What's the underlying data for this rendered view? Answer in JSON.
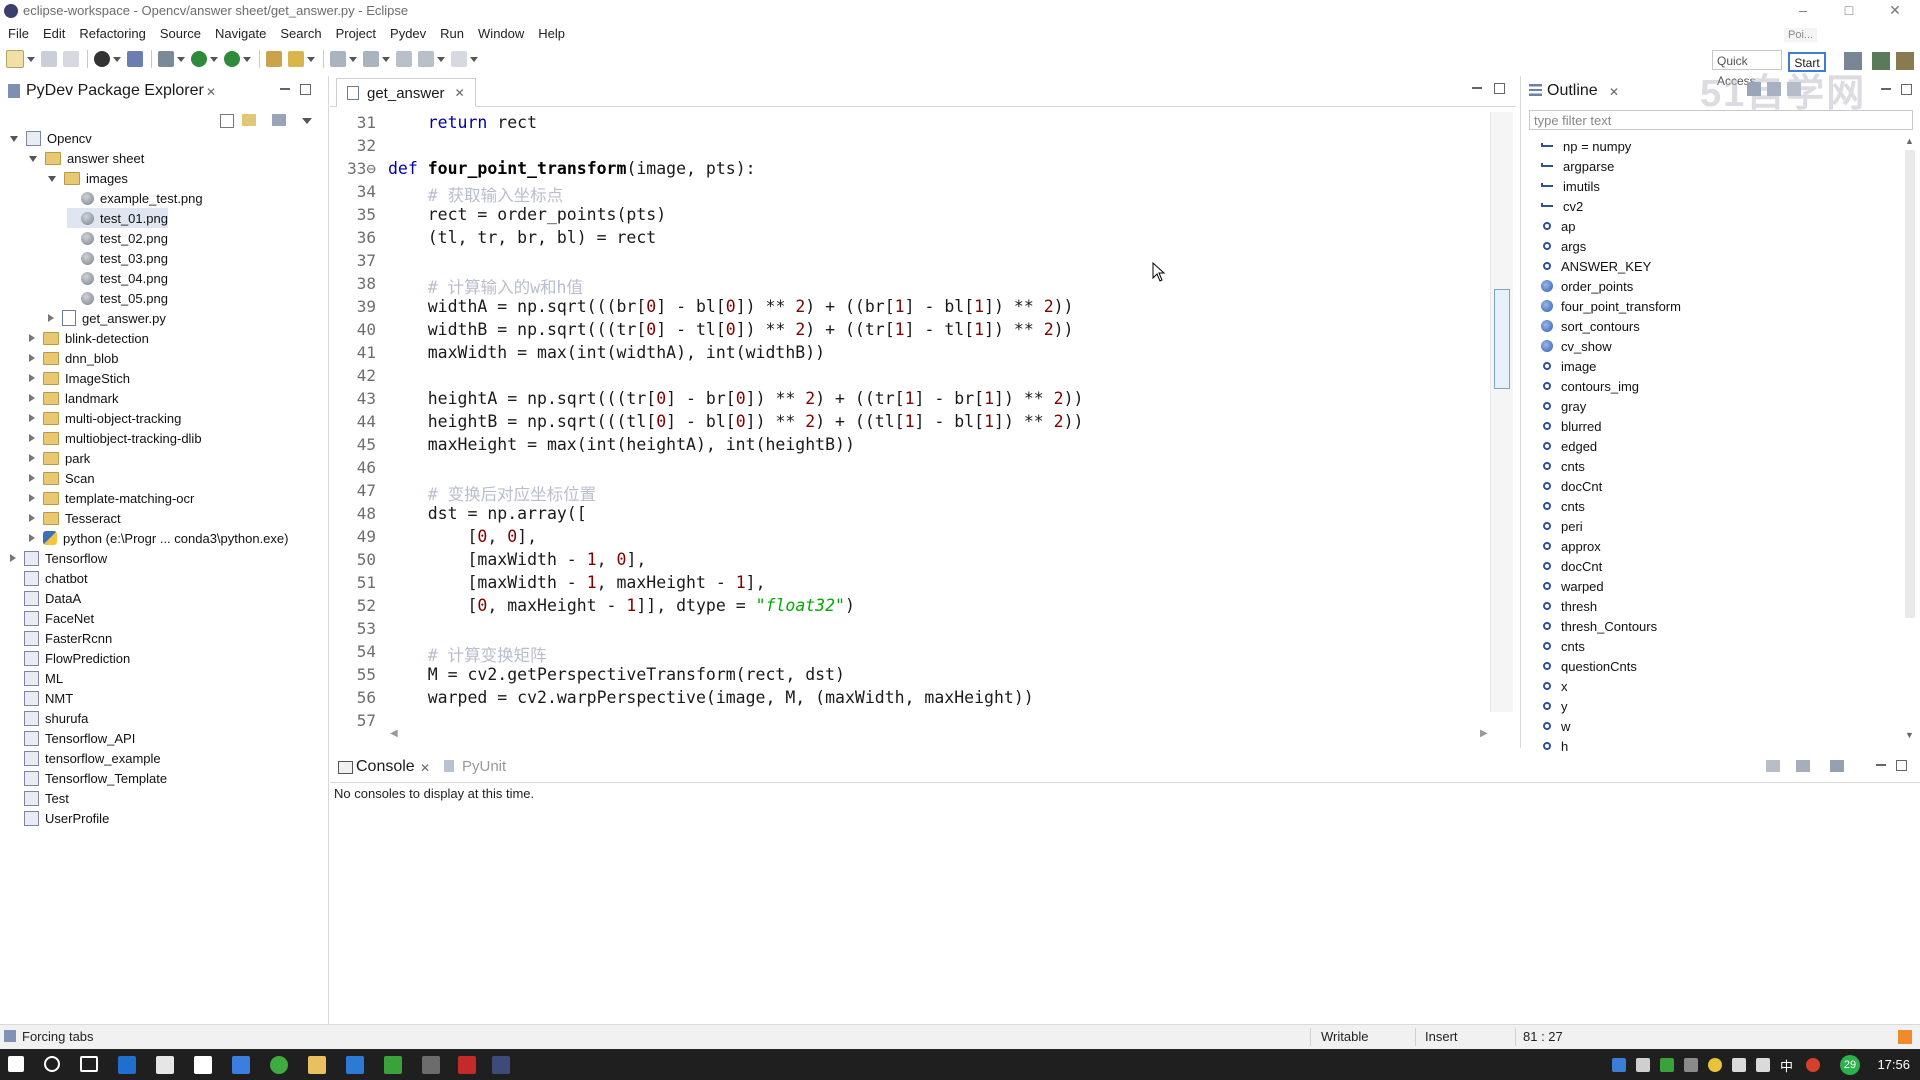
{
  "window": {
    "title": "eclipse-workspace - Opencv/answer sheet/get_answer.py - Eclipse",
    "minimize": "–",
    "maximize": "□",
    "close": "✕"
  },
  "menu": [
    "File",
    "Edit",
    "Refactoring",
    "Source",
    "Navigate",
    "Search",
    "Project",
    "Pydev",
    "Run",
    "Window",
    "Help"
  ],
  "quick_access": {
    "placeholder": "Quick Access",
    "start": "Start",
    "popup": "Poi..."
  },
  "watermark": "51自学网",
  "explorer": {
    "title": "PyDev Package Explorer",
    "tree": [
      {
        "label": "Opencv",
        "indent": 0,
        "twisty": "open",
        "icon": "project"
      },
      {
        "label": "answer sheet",
        "indent": 1,
        "twisty": "open",
        "icon": "folder"
      },
      {
        "label": "images",
        "indent": 2,
        "twisty": "open",
        "icon": "folder"
      },
      {
        "label": "example_test.png",
        "indent": 3,
        "twisty": "none",
        "icon": "file"
      },
      {
        "label": "test_01.png",
        "indent": 3,
        "twisty": "none",
        "icon": "file",
        "selected": true
      },
      {
        "label": "test_02.png",
        "indent": 3,
        "twisty": "none",
        "icon": "file"
      },
      {
        "label": "test_03.png",
        "indent": 3,
        "twisty": "none",
        "icon": "file"
      },
      {
        "label": "test_04.png",
        "indent": 3,
        "twisty": "none",
        "icon": "file"
      },
      {
        "label": "test_05.png",
        "indent": 3,
        "twisty": "none",
        "icon": "file"
      },
      {
        "label": "get_answer.py",
        "indent": 2,
        "twisty": "closed",
        "icon": "py"
      },
      {
        "label": "blink-detection",
        "indent": 1,
        "twisty": "closed",
        "icon": "folder"
      },
      {
        "label": "dnn_blob",
        "indent": 1,
        "twisty": "closed",
        "icon": "folder"
      },
      {
        "label": "ImageStich",
        "indent": 1,
        "twisty": "closed",
        "icon": "folder"
      },
      {
        "label": "landmark",
        "indent": 1,
        "twisty": "closed",
        "icon": "folder"
      },
      {
        "label": "multi-object-tracking",
        "indent": 1,
        "twisty": "closed",
        "icon": "folder"
      },
      {
        "label": "multiobject-tracking-dlib",
        "indent": 1,
        "twisty": "closed",
        "icon": "folder"
      },
      {
        "label": "park",
        "indent": 1,
        "twisty": "closed",
        "icon": "folder"
      },
      {
        "label": "Scan",
        "indent": 1,
        "twisty": "closed",
        "icon": "folder"
      },
      {
        "label": "template-matching-ocr",
        "indent": 1,
        "twisty": "closed",
        "icon": "folder"
      },
      {
        "label": "Tesseract",
        "indent": 1,
        "twisty": "closed",
        "icon": "folder"
      },
      {
        "label": "python  (e:\\Progr ... conda3\\python.exe)",
        "indent": 1,
        "twisty": "closed",
        "icon": "interp"
      },
      {
        "label": "Tensorflow",
        "indent": 0,
        "twisty": "closed",
        "icon": "project"
      },
      {
        "label": "chatbot",
        "indent": 0,
        "twisty": "none",
        "icon": "project"
      },
      {
        "label": "DataA",
        "indent": 0,
        "twisty": "none",
        "icon": "project"
      },
      {
        "label": "FaceNet",
        "indent": 0,
        "twisty": "none",
        "icon": "project"
      },
      {
        "label": "FasterRcnn",
        "indent": 0,
        "twisty": "none",
        "icon": "project"
      },
      {
        "label": "FlowPrediction",
        "indent": 0,
        "twisty": "none",
        "icon": "project"
      },
      {
        "label": "ML",
        "indent": 0,
        "twisty": "none",
        "icon": "project"
      },
      {
        "label": "NMT",
        "indent": 0,
        "twisty": "none",
        "icon": "project"
      },
      {
        "label": "shurufa",
        "indent": 0,
        "twisty": "none",
        "icon": "project"
      },
      {
        "label": "Tensorflow_API",
        "indent": 0,
        "twisty": "none",
        "icon": "project"
      },
      {
        "label": "tensorflow_example",
        "indent": 0,
        "twisty": "none",
        "icon": "project"
      },
      {
        "label": "Tensorflow_Template",
        "indent": 0,
        "twisty": "none",
        "icon": "project"
      },
      {
        "label": "Test",
        "indent": 0,
        "twisty": "none",
        "icon": "project"
      },
      {
        "label": "UserProfile",
        "indent": 0,
        "twisty": "none",
        "icon": "project"
      }
    ]
  },
  "editor": {
    "tab": "get_answer",
    "lines": [
      {
        "n": "31",
        "html": "    <span class='kw'>return</span> rect"
      },
      {
        "n": "32",
        "html": ""
      },
      {
        "n": "33⊖",
        "html": "<span class='kw'>def</span> <span class='fn'>four_point_transform</span>(image, pts):"
      },
      {
        "n": "34",
        "html": "    <span class='cm'># 获取输入坐标点</span>"
      },
      {
        "n": "35",
        "html": "    rect = order_points(pts)"
      },
      {
        "n": "36",
        "html": "    (tl, tr, br, bl) = rect"
      },
      {
        "n": "37",
        "html": ""
      },
      {
        "n": "38",
        "html": "    <span class='cm'># 计算输入的w和h值</span>"
      },
      {
        "n": "39",
        "html": "    widthA = np.sqrt(((br[<span class='num'>0</span>] - bl[<span class='num'>0</span>]) ** <span class='num'>2</span>) + ((br[<span class='num'>1</span>] - bl[<span class='num'>1</span>]) ** <span class='num'>2</span>))"
      },
      {
        "n": "40",
        "html": "    widthB = np.sqrt(((tr[<span class='num'>0</span>] - tl[<span class='num'>0</span>]) ** <span class='num'>2</span>) + ((tr[<span class='num'>1</span>] - tl[<span class='num'>1</span>]) ** <span class='num'>2</span>))"
      },
      {
        "n": "41",
        "html": "    maxWidth = max(int(widthA), int(widthB))"
      },
      {
        "n": "42",
        "html": ""
      },
      {
        "n": "43",
        "html": "    heightA = np.sqrt(((tr[<span class='num'>0</span>] - br[<span class='num'>0</span>]) ** <span class='num'>2</span>) + ((tr[<span class='num'>1</span>] - br[<span class='num'>1</span>]) ** <span class='num'>2</span>))"
      },
      {
        "n": "44",
        "html": "    heightB = np.sqrt(((tl[<span class='num'>0</span>] - bl[<span class='num'>0</span>]) ** <span class='num'>2</span>) + ((tl[<span class='num'>1</span>] - bl[<span class='num'>1</span>]) ** <span class='num'>2</span>))"
      },
      {
        "n": "45",
        "html": "    maxHeight = max(int(heightA), int(heightB))"
      },
      {
        "n": "46",
        "html": ""
      },
      {
        "n": "47",
        "html": "    <span class='cm'># 变换后对应坐标位置</span>"
      },
      {
        "n": "48",
        "html": "    dst = np.array(["
      },
      {
        "n": "49",
        "html": "        [<span class='num'>0</span>, <span class='num'>0</span>],"
      },
      {
        "n": "50",
        "html": "        [maxWidth - <span class='num'>1</span>, <span class='num'>0</span>],"
      },
      {
        "n": "51",
        "html": "        [maxWidth - <span class='num'>1</span>, maxHeight - <span class='num'>1</span>],"
      },
      {
        "n": "52",
        "html": "        [<span class='num'>0</span>, maxHeight - <span class='num'>1</span>]], dtype = <span class='str'>\"float32\"</span>)"
      },
      {
        "n": "53",
        "html": ""
      },
      {
        "n": "54",
        "html": "    <span class='cm'># 计算变换矩阵</span>"
      },
      {
        "n": "55",
        "html": "    M = cv2.getPerspectiveTransform(rect, dst)"
      },
      {
        "n": "56",
        "html": "    warped = cv2.warpPerspective(image, M, (maxWidth, maxHeight))"
      },
      {
        "n": "57",
        "html": ""
      }
    ]
  },
  "outline": {
    "title": "Outline",
    "filter_placeholder": "type filter text",
    "items": [
      {
        "label": "np = numpy",
        "kind": "import"
      },
      {
        "label": "argparse",
        "kind": "import"
      },
      {
        "label": "imutils",
        "kind": "import"
      },
      {
        "label": "cv2",
        "kind": "import"
      },
      {
        "label": "ap",
        "kind": "attr"
      },
      {
        "label": "args",
        "kind": "attr"
      },
      {
        "label": "ANSWER_KEY",
        "kind": "attr"
      },
      {
        "label": "order_points",
        "kind": "func"
      },
      {
        "label": "four_point_transform",
        "kind": "func"
      },
      {
        "label": "sort_contours",
        "kind": "func"
      },
      {
        "label": "cv_show",
        "kind": "func"
      },
      {
        "label": "image",
        "kind": "attr"
      },
      {
        "label": "contours_img",
        "kind": "attr"
      },
      {
        "label": "gray",
        "kind": "attr"
      },
      {
        "label": "blurred",
        "kind": "attr"
      },
      {
        "label": "edged",
        "kind": "attr"
      },
      {
        "label": "cnts",
        "kind": "attr"
      },
      {
        "label": "docCnt",
        "kind": "attr"
      },
      {
        "label": "cnts",
        "kind": "attr"
      },
      {
        "label": "peri",
        "kind": "attr"
      },
      {
        "label": "approx",
        "kind": "attr"
      },
      {
        "label": "docCnt",
        "kind": "attr"
      },
      {
        "label": "warped",
        "kind": "attr"
      },
      {
        "label": "thresh",
        "kind": "attr"
      },
      {
        "label": "thresh_Contours",
        "kind": "attr"
      },
      {
        "label": "cnts",
        "kind": "attr"
      },
      {
        "label": "questionCnts",
        "kind": "attr"
      },
      {
        "label": "x",
        "kind": "attr"
      },
      {
        "label": "y",
        "kind": "attr"
      },
      {
        "label": "w",
        "kind": "attr"
      },
      {
        "label": "h",
        "kind": "attr"
      }
    ]
  },
  "console": {
    "tab": "Console",
    "tab2": "PyUnit",
    "message": "No consoles to display at this time."
  },
  "status": {
    "left": "Forcing tabs",
    "writable": "Writable",
    "insert": "Insert",
    "position": "81 : 27"
  },
  "taskbar": {
    "time": "17:56",
    "badge": "29",
    "ime": "中"
  },
  "colors": {
    "keyword": "#0000a8",
    "number": "#800000",
    "string": "#00aa00",
    "comment": "#b8bed0",
    "taskbar": "#1f1f1f"
  }
}
